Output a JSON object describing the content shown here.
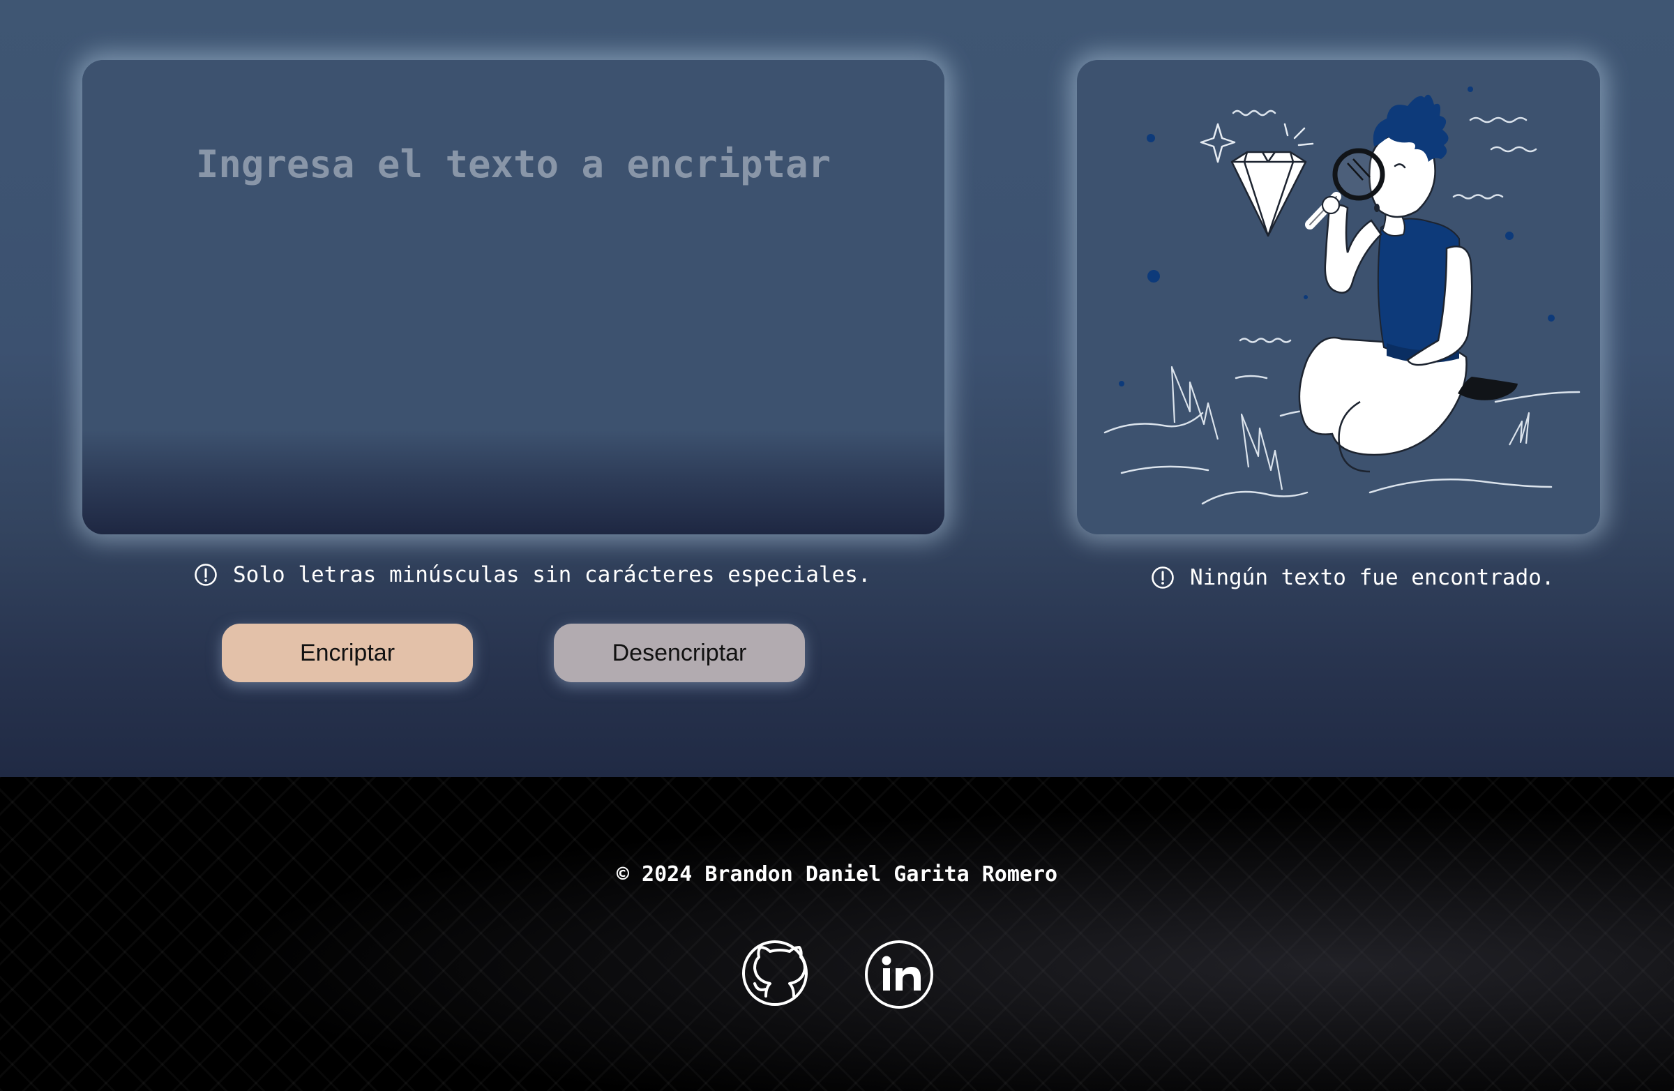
{
  "input": {
    "placeholder": "Ingresa el texto a encriptar",
    "value": ""
  },
  "notes": {
    "input_hint": "Solo letras minúsculas sin carácteres especiales.",
    "output_status": "Ningún texto fue encontrado."
  },
  "buttons": {
    "encrypt_label": "Encriptar",
    "decrypt_label": "Desencriptar"
  },
  "illustration": {
    "icon": "person-magnifier-diamond-illustration"
  },
  "footer": {
    "copyright": "© 2024 Brandon Daniel Garita Romero",
    "links": [
      {
        "name": "github",
        "icon": "github-icon"
      },
      {
        "name": "linkedin",
        "icon": "linkedin-icon"
      }
    ]
  },
  "colors": {
    "encrypt_button": "#e3c1a9",
    "decrypt_button": "#b2abb0",
    "card": "#3d526f",
    "accent_blue": "#0d3a7a"
  }
}
